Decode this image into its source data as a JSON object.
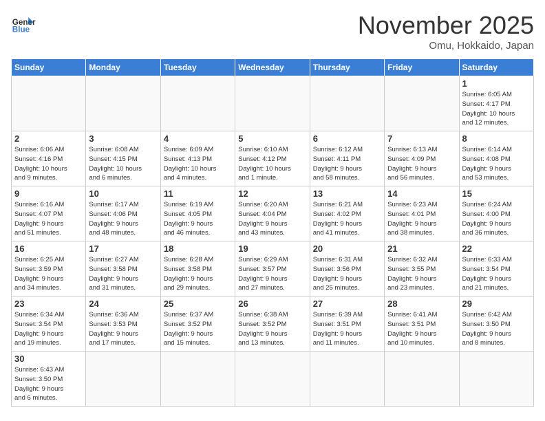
{
  "header": {
    "logo_general": "General",
    "logo_blue": "Blue",
    "month_title": "November 2025",
    "location": "Omu, Hokkaido, Japan"
  },
  "days_of_week": [
    "Sunday",
    "Monday",
    "Tuesday",
    "Wednesday",
    "Thursday",
    "Friday",
    "Saturday"
  ],
  "weeks": [
    [
      {
        "day": "",
        "info": ""
      },
      {
        "day": "",
        "info": ""
      },
      {
        "day": "",
        "info": ""
      },
      {
        "day": "",
        "info": ""
      },
      {
        "day": "",
        "info": ""
      },
      {
        "day": "",
        "info": ""
      },
      {
        "day": "1",
        "info": "Sunrise: 6:05 AM\nSunset: 4:17 PM\nDaylight: 10 hours\nand 12 minutes."
      }
    ],
    [
      {
        "day": "2",
        "info": "Sunrise: 6:06 AM\nSunset: 4:16 PM\nDaylight: 10 hours\nand 9 minutes."
      },
      {
        "day": "3",
        "info": "Sunrise: 6:08 AM\nSunset: 4:15 PM\nDaylight: 10 hours\nand 6 minutes."
      },
      {
        "day": "4",
        "info": "Sunrise: 6:09 AM\nSunset: 4:13 PM\nDaylight: 10 hours\nand 4 minutes."
      },
      {
        "day": "5",
        "info": "Sunrise: 6:10 AM\nSunset: 4:12 PM\nDaylight: 10 hours\nand 1 minute."
      },
      {
        "day": "6",
        "info": "Sunrise: 6:12 AM\nSunset: 4:11 PM\nDaylight: 9 hours\nand 58 minutes."
      },
      {
        "day": "7",
        "info": "Sunrise: 6:13 AM\nSunset: 4:09 PM\nDaylight: 9 hours\nand 56 minutes."
      },
      {
        "day": "8",
        "info": "Sunrise: 6:14 AM\nSunset: 4:08 PM\nDaylight: 9 hours\nand 53 minutes."
      }
    ],
    [
      {
        "day": "9",
        "info": "Sunrise: 6:16 AM\nSunset: 4:07 PM\nDaylight: 9 hours\nand 51 minutes."
      },
      {
        "day": "10",
        "info": "Sunrise: 6:17 AM\nSunset: 4:06 PM\nDaylight: 9 hours\nand 48 minutes."
      },
      {
        "day": "11",
        "info": "Sunrise: 6:19 AM\nSunset: 4:05 PM\nDaylight: 9 hours\nand 46 minutes."
      },
      {
        "day": "12",
        "info": "Sunrise: 6:20 AM\nSunset: 4:04 PM\nDaylight: 9 hours\nand 43 minutes."
      },
      {
        "day": "13",
        "info": "Sunrise: 6:21 AM\nSunset: 4:02 PM\nDaylight: 9 hours\nand 41 minutes."
      },
      {
        "day": "14",
        "info": "Sunrise: 6:23 AM\nSunset: 4:01 PM\nDaylight: 9 hours\nand 38 minutes."
      },
      {
        "day": "15",
        "info": "Sunrise: 6:24 AM\nSunset: 4:00 PM\nDaylight: 9 hours\nand 36 minutes."
      }
    ],
    [
      {
        "day": "16",
        "info": "Sunrise: 6:25 AM\nSunset: 3:59 PM\nDaylight: 9 hours\nand 34 minutes."
      },
      {
        "day": "17",
        "info": "Sunrise: 6:27 AM\nSunset: 3:58 PM\nDaylight: 9 hours\nand 31 minutes."
      },
      {
        "day": "18",
        "info": "Sunrise: 6:28 AM\nSunset: 3:58 PM\nDaylight: 9 hours\nand 29 minutes."
      },
      {
        "day": "19",
        "info": "Sunrise: 6:29 AM\nSunset: 3:57 PM\nDaylight: 9 hours\nand 27 minutes."
      },
      {
        "day": "20",
        "info": "Sunrise: 6:31 AM\nSunset: 3:56 PM\nDaylight: 9 hours\nand 25 minutes."
      },
      {
        "day": "21",
        "info": "Sunrise: 6:32 AM\nSunset: 3:55 PM\nDaylight: 9 hours\nand 23 minutes."
      },
      {
        "day": "22",
        "info": "Sunrise: 6:33 AM\nSunset: 3:54 PM\nDaylight: 9 hours\nand 21 minutes."
      }
    ],
    [
      {
        "day": "23",
        "info": "Sunrise: 6:34 AM\nSunset: 3:54 PM\nDaylight: 9 hours\nand 19 minutes."
      },
      {
        "day": "24",
        "info": "Sunrise: 6:36 AM\nSunset: 3:53 PM\nDaylight: 9 hours\nand 17 minutes."
      },
      {
        "day": "25",
        "info": "Sunrise: 6:37 AM\nSunset: 3:52 PM\nDaylight: 9 hours\nand 15 minutes."
      },
      {
        "day": "26",
        "info": "Sunrise: 6:38 AM\nSunset: 3:52 PM\nDaylight: 9 hours\nand 13 minutes."
      },
      {
        "day": "27",
        "info": "Sunrise: 6:39 AM\nSunset: 3:51 PM\nDaylight: 9 hours\nand 11 minutes."
      },
      {
        "day": "28",
        "info": "Sunrise: 6:41 AM\nSunset: 3:51 PM\nDaylight: 9 hours\nand 10 minutes."
      },
      {
        "day": "29",
        "info": "Sunrise: 6:42 AM\nSunset: 3:50 PM\nDaylight: 9 hours\nand 8 minutes."
      }
    ],
    [
      {
        "day": "30",
        "info": "Sunrise: 6:43 AM\nSunset: 3:50 PM\nDaylight: 9 hours\nand 6 minutes."
      },
      {
        "day": "",
        "info": ""
      },
      {
        "day": "",
        "info": ""
      },
      {
        "day": "",
        "info": ""
      },
      {
        "day": "",
        "info": ""
      },
      {
        "day": "",
        "info": ""
      },
      {
        "day": "",
        "info": ""
      }
    ]
  ]
}
